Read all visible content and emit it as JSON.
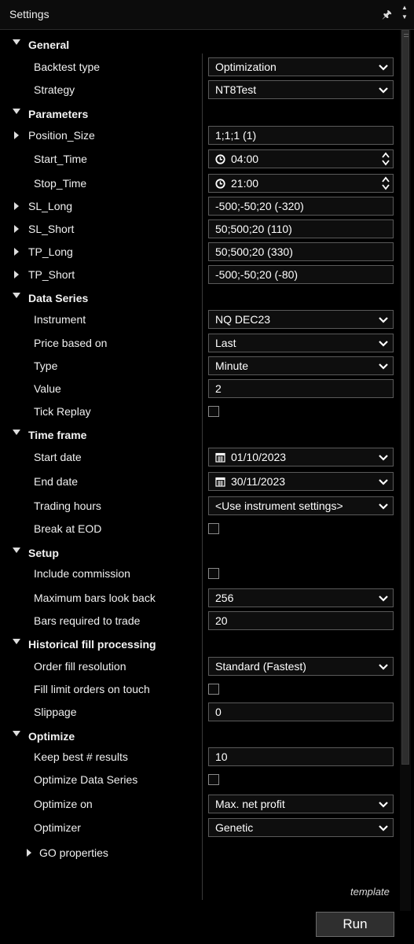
{
  "window": {
    "title": "Settings"
  },
  "sections": {
    "general": {
      "label": "General",
      "backtest_type": {
        "label": "Backtest type",
        "value": "Optimization"
      },
      "strategy": {
        "label": "Strategy",
        "value": "NT8Test"
      }
    },
    "parameters": {
      "label": "Parameters",
      "position_size": {
        "label": "Position_Size",
        "value": "1;1;1 (1)"
      },
      "start_time": {
        "label": "Start_Time",
        "value": "04:00"
      },
      "stop_time": {
        "label": "Stop_Time",
        "value": "21:00"
      },
      "sl_long": {
        "label": "SL_Long",
        "value": "-500;-50;20 (-320)"
      },
      "sl_short": {
        "label": "SL_Short",
        "value": "50;500;20 (110)"
      },
      "tp_long": {
        "label": "TP_Long",
        "value": "50;500;20 (330)"
      },
      "tp_short": {
        "label": "TP_Short",
        "value": "-500;-50;20 (-80)"
      }
    },
    "data_series": {
      "label": "Data Series",
      "instrument": {
        "label": "Instrument",
        "value": "NQ DEC23"
      },
      "price_based_on": {
        "label": "Price based on",
        "value": "Last"
      },
      "type": {
        "label": "Type",
        "value": "Minute"
      },
      "value": {
        "label": "Value",
        "value": "2"
      },
      "tick_replay": {
        "label": "Tick Replay",
        "checked": false
      }
    },
    "time_frame": {
      "label": "Time frame",
      "start_date": {
        "label": "Start date",
        "value": "01/10/2023"
      },
      "end_date": {
        "label": "End date",
        "value": "30/11/2023"
      },
      "trading_hours": {
        "label": "Trading hours",
        "value": "<Use instrument settings>"
      },
      "break_at_eod": {
        "label": "Break at EOD",
        "checked": false
      }
    },
    "setup": {
      "label": "Setup",
      "include_commission": {
        "label": "Include commission",
        "checked": false
      },
      "max_bars_look_back": {
        "label": "Maximum bars look back",
        "value": "256"
      },
      "bars_required": {
        "label": "Bars required to trade",
        "value": "20"
      }
    },
    "historical_fill": {
      "label": "Historical fill processing",
      "order_fill_resolution": {
        "label": "Order fill resolution",
        "value": "Standard (Fastest)"
      },
      "fill_limit_orders": {
        "label": "Fill limit orders on touch",
        "checked": false
      },
      "slippage": {
        "label": "Slippage",
        "value": "0"
      }
    },
    "optimize": {
      "label": "Optimize",
      "keep_best": {
        "label": "Keep best # results",
        "value": "10"
      },
      "optimize_data_series": {
        "label": "Optimize Data Series",
        "checked": false
      },
      "optimize_on": {
        "label": "Optimize on",
        "value": "Max. net profit"
      },
      "optimizer": {
        "label": "Optimizer",
        "value": "Genetic"
      },
      "go_properties": {
        "label": "GO properties"
      }
    }
  },
  "footer": {
    "template_label": "template",
    "run_label": "Run"
  }
}
